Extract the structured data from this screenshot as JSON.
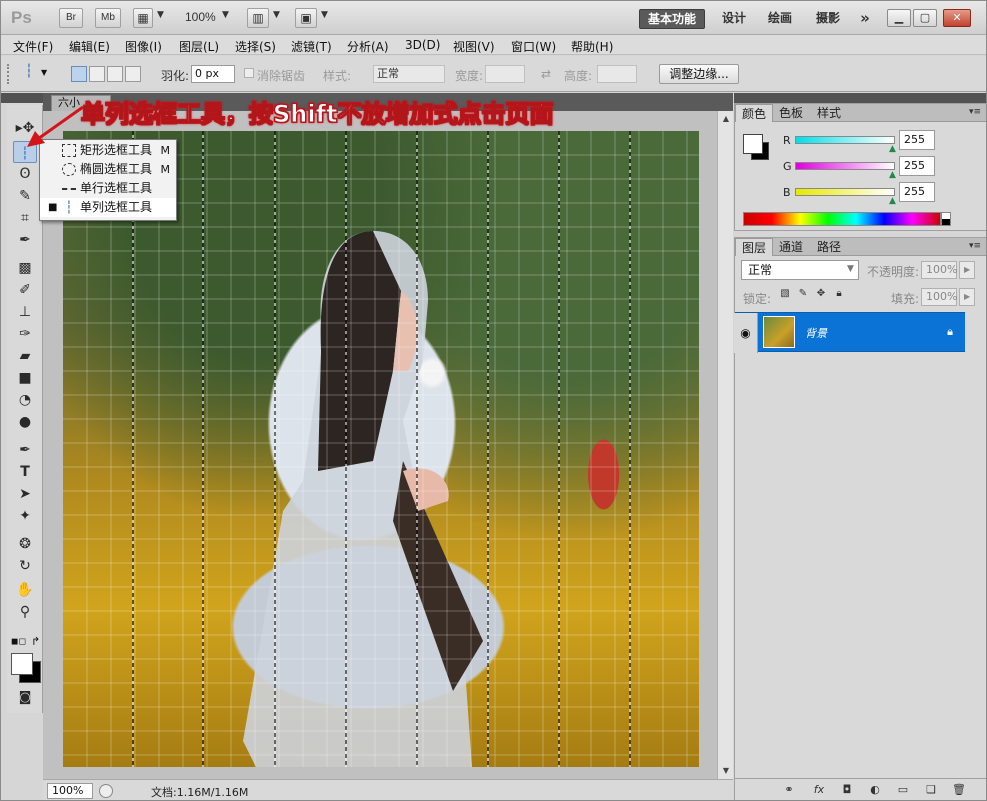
{
  "app": {
    "logo": "Ps",
    "bridge_label": "Br",
    "minibridge_label": "Mb",
    "zoom": "100%"
  },
  "workspaces": {
    "basic": "基本功能",
    "design": "设计",
    "painting": "绘画",
    "photography": "摄影",
    "more": "»"
  },
  "menu": [
    "文件(F)",
    "编辑(E)",
    "图像(I)",
    "图层(L)",
    "选择(S)",
    "滤镜(T)",
    "分析(A)",
    "3D(D)",
    "视图(V)",
    "窗口(W)",
    "帮助(H)"
  ],
  "options": {
    "feather_label": "羽化:",
    "feather_value": "0 px",
    "antialias_label": "消除锯齿",
    "style_label": "样式:",
    "style_value": "正常",
    "width_label": "宽度:",
    "height_label": "高度:",
    "refine_edge": "调整边缘..."
  },
  "document": {
    "tab_label": "六小",
    "zoom_field": "100%",
    "doc_info": "文档:1.16M/1.16M"
  },
  "flyout": {
    "items": [
      {
        "label": "矩形选框工具",
        "key": "M",
        "icon": "rect-marquee-icon"
      },
      {
        "label": "椭圆选框工具",
        "key": "M",
        "icon": "ellipse-marquee-icon"
      },
      {
        "label": "单行选框工具",
        "key": "",
        "icon": "row-marquee-icon"
      },
      {
        "label": "单列选框工具",
        "key": "",
        "icon": "column-marquee-icon",
        "selected": true
      }
    ]
  },
  "annotation": {
    "text": "单列选框工具，按Shift不放增加式点击页面",
    "color": "#c8161c"
  },
  "color_panel": {
    "tabs": [
      "颜色",
      "色板",
      "样式"
    ],
    "channels": [
      {
        "label": "R",
        "value": "255",
        "color": "#00d8e8"
      },
      {
        "label": "G",
        "value": "255",
        "color": "#e000e0"
      },
      {
        "label": "B",
        "value": "255",
        "color": "#e8e800"
      }
    ]
  },
  "layers_panel": {
    "tabs": [
      "图层",
      "通道",
      "路径"
    ],
    "blend_mode": "正常",
    "opacity_label": "不透明度:",
    "opacity_value": "100%",
    "lock_label": "锁定:",
    "fill_label": "填充:",
    "fill_value": "100%",
    "layer_name": "背景"
  },
  "colors": {
    "selection_accent": "#0b72d6",
    "workspace_active": "#5a5a5a"
  }
}
